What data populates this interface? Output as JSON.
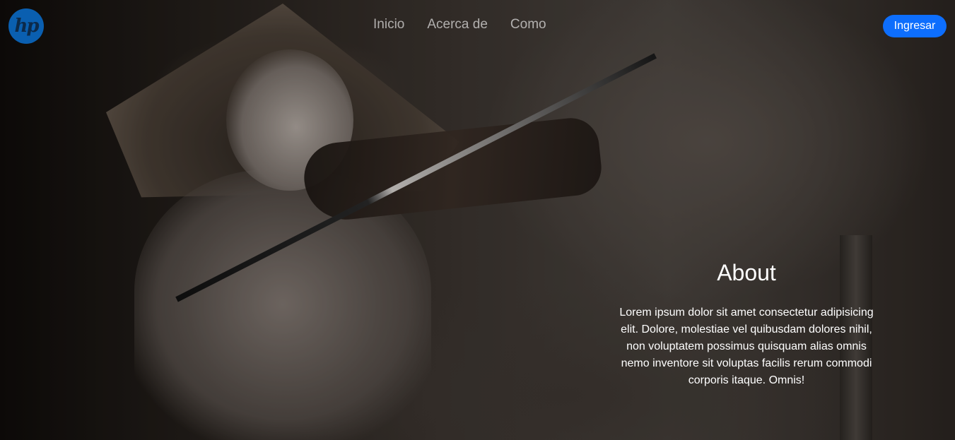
{
  "brand": {
    "logo_text": "hp",
    "accent_color": "#0d6efd",
    "logo_color": "#0a5fb0"
  },
  "nav": {
    "links": [
      {
        "label": "Inicio"
      },
      {
        "label": "Acerca de"
      },
      {
        "label": "Como"
      }
    ],
    "login_label": "Ingresar"
  },
  "hero": {
    "image_description_icon": "photo-boy-violin"
  },
  "about": {
    "title": "About",
    "text": "Lorem ipsum dolor sit amet consectetur adipisicing elit. Dolore, molestiae vel quibusdam dolores nihil, non voluptatem possimus quisquam alias omnis nemo inventore sit voluptas facilis rerum commodi corporis itaque. Omnis!"
  }
}
